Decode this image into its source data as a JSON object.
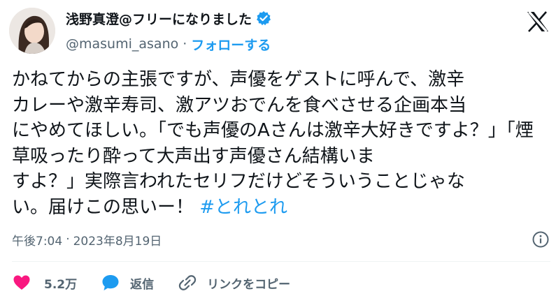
{
  "header": {
    "display_name": "浅野真澄@フリーになりました",
    "handle": "@masumi_asano",
    "separator": "·",
    "follow_label": "フォローする"
  },
  "tweet": {
    "text": "かねてからの主張ですが、声優をゲストに呼んで、激辛\nカレーや激辛寿司、激アツおでんを食べさせる企画本当\nにやめてほしい。「でも声優のAさんは激辛大好きですよ？」「煙草吸ったり酔って大声出す声優さん結構いま\nすよ？」実際言われたセリフだけどそういうことじゃな\nい。届けこの思いー！ ",
    "hashtag": "#とれとれ",
    "time": "午後7:04",
    "meta_separator": "·",
    "date": "2023年8月19日"
  },
  "actions": {
    "like_count": "5.2万",
    "reply_label": "返信",
    "copy_link_label": "リンクをコピー"
  },
  "colors": {
    "accent": "#1d9bf0",
    "like": "#f91880",
    "secondary_text": "#536471",
    "verified_badge": "#1d9bf0"
  },
  "icons": [
    "verified-badge-icon",
    "x-logo-icon",
    "info-icon",
    "heart-icon",
    "reply-bubble-icon",
    "link-icon"
  ]
}
